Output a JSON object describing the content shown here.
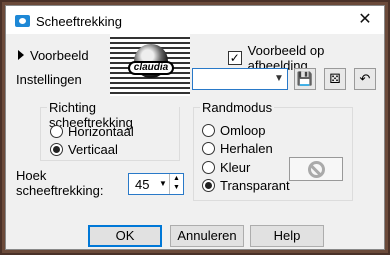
{
  "window": {
    "title": "Scheeftrekking",
    "close_glyph": "✕"
  },
  "preview": {
    "toggle_label": "Voorbeeld",
    "show_on_image_label": "Voorbeeld op afbeelding",
    "show_on_image_checked": true,
    "watermark_text": "claudia"
  },
  "settings": {
    "label": "Instellingen",
    "preset_value": ""
  },
  "direction": {
    "title": "Richting scheeftrekking",
    "options": [
      {
        "label": "Horizontaal",
        "selected": false
      },
      {
        "label": "Verticaal",
        "selected": true
      }
    ]
  },
  "edge_mode": {
    "title": "Randmodus",
    "options": [
      {
        "label": "Omloop",
        "selected": false
      },
      {
        "label": "Herhalen",
        "selected": false
      },
      {
        "label": "Kleur",
        "selected": false
      },
      {
        "label": "Transparant",
        "selected": true
      }
    ]
  },
  "angle": {
    "label_line1": "Hoek",
    "label_line2": "scheeftrekking:",
    "value": "45"
  },
  "buttons": {
    "ok": "OK",
    "cancel": "Annuleren",
    "help": "Help"
  },
  "icons": [
    "camera-icon",
    "close-icon",
    "expand-triangle-icon",
    "save-preset-icon",
    "randomize-icon",
    "reset-icon",
    "no-color-icon",
    "spin-up-icon",
    "spin-down-icon",
    "dropdown-arrow-icon"
  ]
}
